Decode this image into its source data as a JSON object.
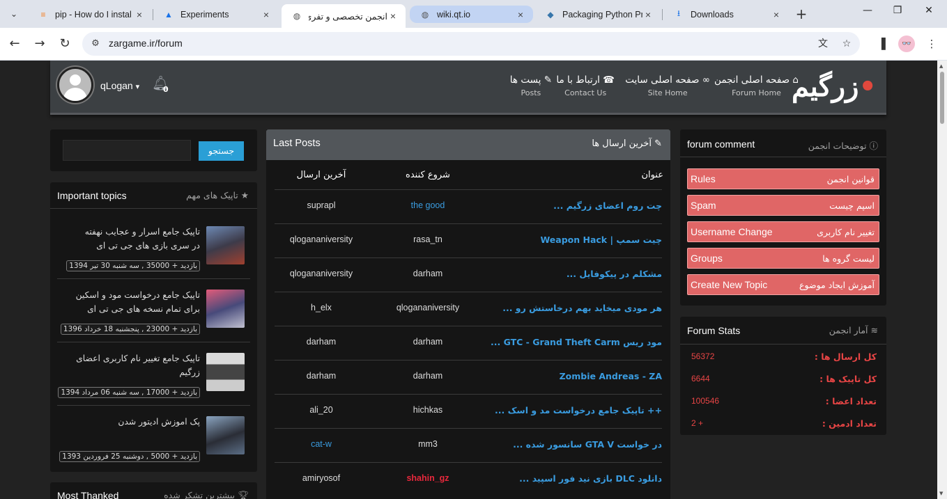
{
  "browser": {
    "tabs": [
      {
        "title": "pip - How do I instal",
        "icon": "stack-overflow-icon"
      },
      {
        "title": "Experiments",
        "icon": "flask-icon"
      },
      {
        "title": "انجمن تخصصی و تفری",
        "icon": "globe-icon"
      },
      {
        "title": "wiki.qt.io",
        "icon": "globe-icon"
      },
      {
        "title": "Packaging Python Pr",
        "icon": "python-icon"
      },
      {
        "title": "Downloads",
        "icon": "download-icon"
      }
    ],
    "url": "zargame.ir/forum"
  },
  "header": {
    "logo": "زرگیم",
    "nav": [
      {
        "fa": "صفحه اصلی انجمن",
        "en": "Forum Home",
        "icon": "home-icon"
      },
      {
        "fa": "صفحه اصلی سایت",
        "en": "Site Home",
        "icon": "link-icon"
      },
      {
        "fa": "ارتباط با ما",
        "en": "Contact Us",
        "icon": "phone-icon"
      },
      {
        "fa": "پست ها",
        "en": "Posts",
        "icon": "pencil-icon"
      }
    ],
    "username": "qLogan",
    "notifications": "0"
  },
  "left": {
    "search_button": "جستجو",
    "important": {
      "en": "Important topics",
      "fa": "تاپیک های مهم",
      "topics": [
        {
          "title": "تاپیک جامع اسرار و عجایب نهفته در سری بازی های جی تی ای",
          "meta": "بازدید + 35000 , سه شنبه 30 تیر 1394"
        },
        {
          "title": "تاپیک جامع درخواست مود و اسکین برای تمام نسخه های جی تی ای",
          "meta": "بازدید + 23000 , پنجشنبه 18 خرداد 1396"
        },
        {
          "title": "تاپیک جامع تغییر نام کاربری اعضای زرگیم",
          "meta": "بازدید + 17000 , سه شنبه 06 مرداد 1394"
        },
        {
          "title": "پک اموزش ادیتور شدن",
          "meta": "بازدید + 5000 , دوشنبه 25 فروردین 1393"
        }
      ]
    },
    "most_thanked": {
      "en": "Most Thanked",
      "fa": "بیشترین تشکر شده"
    }
  },
  "center": {
    "en": "Last Posts",
    "fa": "آخرین ارسال ها",
    "columns": {
      "title": "عنوان",
      "starter": "شروع کننده",
      "last": "آخرین ارسال"
    },
    "rows": [
      {
        "title": "چت روم اعضای زرگیم ...",
        "starter": "the good",
        "last": "suprapl"
      },
      {
        "title": "چیت سمپ | Weapon Hack",
        "starter": "rasa_tn",
        "last": "qlogananiversity"
      },
      {
        "title": "مشکلم در پیکوفایل ...",
        "starter": "darham",
        "last": "qlogananiversity"
      },
      {
        "title": "هر مودی میخاید بهم درخاستش رو ...",
        "starter": "qlogananiversity",
        "last": "h_elx"
      },
      {
        "title": "مود ریس GTC - Grand Theft Carm ...",
        "starter": "darham",
        "last": "darham"
      },
      {
        "title": "Zombie Andreas - ZA",
        "starter": "darham",
        "last": "darham"
      },
      {
        "title": "++ تاپیک جامع درخواست مد و اسک ...",
        "starter": "hichkas",
        "last": "ali_20"
      },
      {
        "title": "در خواست GTA V سانسور شده ...",
        "starter": "mm3",
        "last": "cat-w"
      },
      {
        "title": "دانلود DLC بازی نید فور اسپید ...",
        "starter": "shahin_gz",
        "last": "amiryosof"
      }
    ]
  },
  "right": {
    "comment": {
      "en": "forum comment",
      "fa": "توضیحات انجمن",
      "buttons": [
        {
          "en": "Rules",
          "fa": "قوانین انجمن"
        },
        {
          "en": "Spam",
          "fa": "اسپم چیست"
        },
        {
          "en": "Username Change",
          "fa": "تغییر نام کاربری"
        },
        {
          "en": "Groups",
          "fa": "لیست گروه ها"
        },
        {
          "en": "Create New Topic",
          "fa": "آموزش ایجاد موضوع"
        }
      ]
    },
    "stats": {
      "en": "Forum Stats",
      "fa": "آمار انجمن",
      "items": [
        {
          "label": "کل ارسال ها :",
          "value": "56372"
        },
        {
          "label": "کل تاپیک ها :",
          "value": "6644"
        },
        {
          "label": "تعداد اعضا :",
          "value": "100546"
        },
        {
          "label": "تعداد ادمین :",
          "value": "2 +"
        }
      ]
    }
  }
}
